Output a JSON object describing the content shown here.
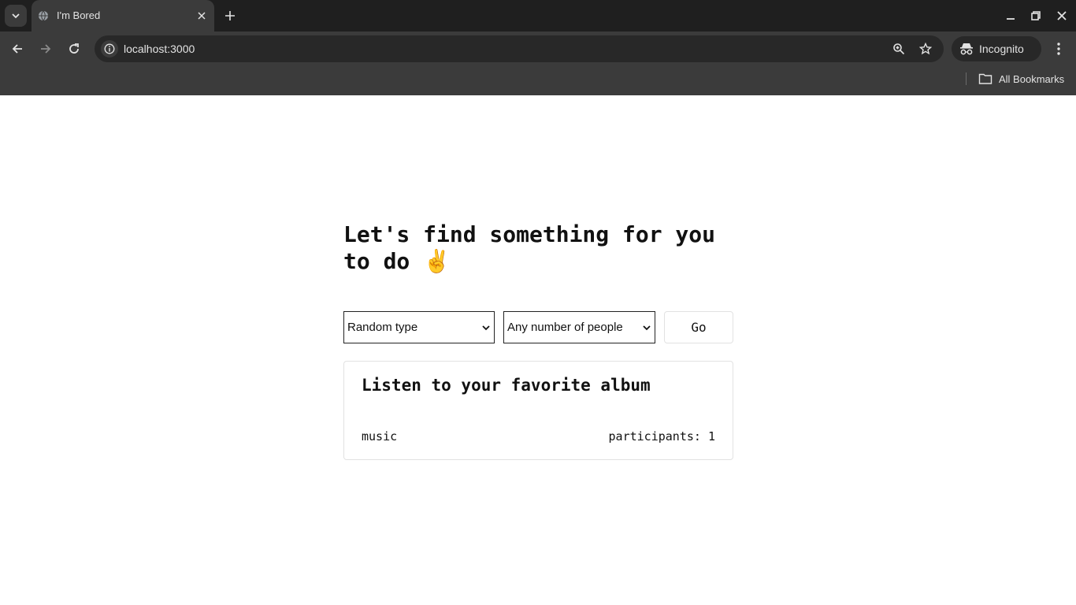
{
  "browser": {
    "tab_title": "I'm Bored",
    "url": "localhost:3000",
    "profile_label": "Incognito",
    "bookmarks_label": "All Bookmarks"
  },
  "page": {
    "heading": "Let's find something for you to do ✌️",
    "type_select": {
      "selected": "Random type"
    },
    "people_select": {
      "selected": "Any number of people"
    },
    "go_label": "Go",
    "activity": {
      "title": "Listen to your favorite album",
      "type": "music",
      "participants_text": "participants: 1"
    }
  },
  "colors": {
    "chrome_dark": "#1f1f1f",
    "chrome_mid": "#3b3b3b",
    "omnibox": "#282828",
    "card_border": "#e2e2e2"
  }
}
